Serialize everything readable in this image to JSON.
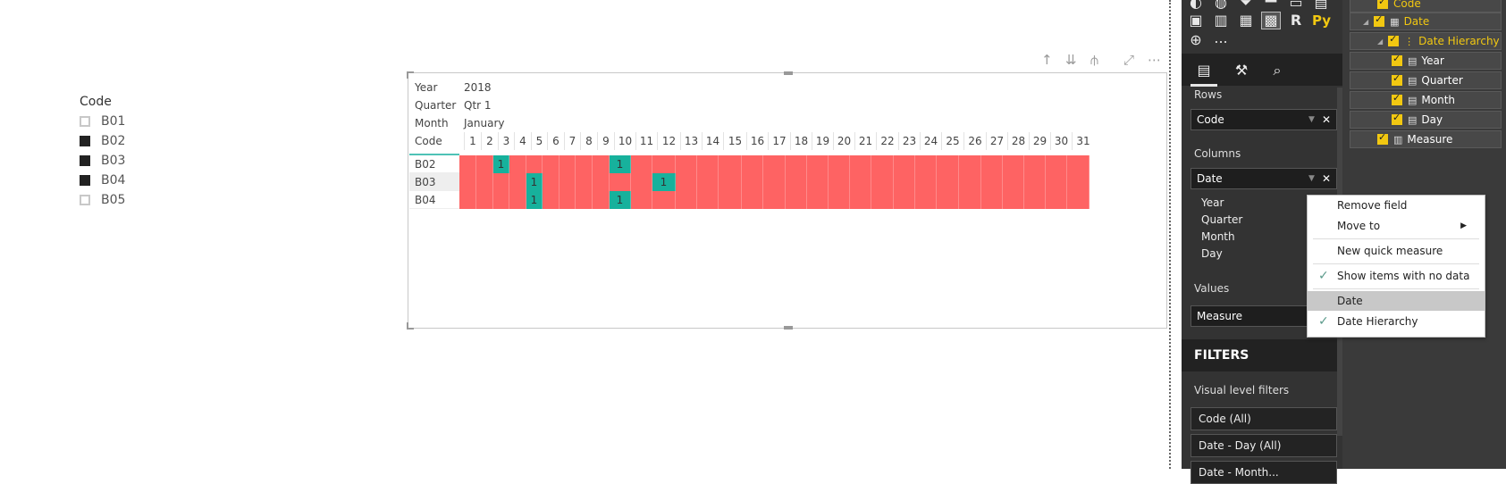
{
  "slicer": {
    "title": "Code",
    "items": [
      {
        "label": "B01",
        "checked": false
      },
      {
        "label": "B02",
        "checked": true
      },
      {
        "label": "B03",
        "checked": true
      },
      {
        "label": "B04",
        "checked": true
      },
      {
        "label": "B05",
        "checked": false
      }
    ]
  },
  "matrix": {
    "header_rows": [
      {
        "label": "Year",
        "value": "2018"
      },
      {
        "label": "Quarter",
        "value": "Qtr 1"
      },
      {
        "label": "Month",
        "value": "January"
      }
    ],
    "code_header": "Code",
    "days": [
      "1",
      "2",
      "3",
      "4",
      "5",
      "6",
      "7",
      "8",
      "9",
      "10",
      "11",
      "12",
      "13",
      "14",
      "15",
      "16",
      "17",
      "18",
      "19",
      "20",
      "21",
      "22",
      "23",
      "24",
      "25",
      "26",
      "27",
      "28",
      "29",
      "30",
      "31"
    ],
    "rows": [
      {
        "code": "B02",
        "values_on_days": [
          3,
          10
        ],
        "selected": false
      },
      {
        "code": "B03",
        "values_on_days": [
          5,
          12
        ],
        "selected": true
      },
      {
        "code": "B04",
        "values_on_days": [
          5,
          10
        ],
        "selected": false
      }
    ],
    "cell_value": "1",
    "colors": {
      "empty": "#fe6363",
      "filled": "#17b19c"
    }
  },
  "visual_header_icons": [
    "arrow-up-icon",
    "double-arrow-down-icon",
    "hierarchy-expand-icon",
    "focus-mode-icon",
    "more-options-icon"
  ],
  "visualizations": {
    "python_label": "Py",
    "r_label": "R",
    "more_label": "...",
    "rows_label": "Rows",
    "rows_field": "Code",
    "columns_label": "Columns",
    "columns_field": "Date",
    "columns_subfields": [
      "Year",
      "Quarter",
      "Month",
      "Day"
    ],
    "values_label": "Values",
    "values_field": "Measure",
    "filters_title": "FILTERS",
    "visual_level_filters": "Visual level filters",
    "filters": [
      "Code (All)",
      "Date - Day (All)",
      "Date - Month..."
    ]
  },
  "fields": {
    "items": [
      {
        "label": "Code",
        "level": 2
      },
      {
        "label": "Date",
        "level": 1,
        "type": "table"
      },
      {
        "label": "Date Hierarchy",
        "level": 2,
        "type": "hierarchy"
      },
      {
        "label": "Year",
        "level": 3
      },
      {
        "label": "Quarter",
        "level": 3
      },
      {
        "label": "Month",
        "level": 3
      },
      {
        "label": "Day",
        "level": 3
      },
      {
        "label": "Measure",
        "level": 2,
        "type": "measure"
      }
    ],
    "accent": "#f2c811"
  },
  "context_menu": {
    "items": [
      {
        "label": "Remove field",
        "check": false,
        "submenu": false
      },
      {
        "label": "Move to",
        "check": false,
        "submenu": true
      },
      {
        "label": "New quick measure",
        "check": false,
        "submenu": false
      },
      {
        "label": "Show items with no data",
        "check": true,
        "submenu": false
      },
      {
        "label": "Date",
        "check": false,
        "submenu": false,
        "highlighted": true
      },
      {
        "label": "Date Hierarchy",
        "check": true,
        "submenu": false
      }
    ]
  }
}
